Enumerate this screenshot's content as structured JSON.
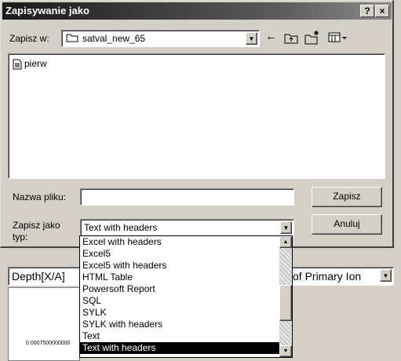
{
  "dialog": {
    "title": "Zapisywanie jako",
    "help_label": "?",
    "close_label": "×",
    "savein_label": "Zapisz w:",
    "folder": "satval_new_65",
    "files": [
      "pierw"
    ],
    "filename_label": "Nazwa pliku:",
    "filename_value": "",
    "type_label_line1": "Zapisz jako",
    "type_label_line2": "typ:",
    "type_value": "Text with headers",
    "save_button": "Zapisz",
    "cancel_button": "Anuluj"
  },
  "type_options": [
    "Excel with headers",
    "Excel5",
    "Excel5 with headers",
    "HTML Table",
    "Powersoft Report",
    "SQL",
    "SYLK",
    "SYLK with headers",
    "Text",
    "Text with headers"
  ],
  "background": {
    "depth_select": "Depth[X/A]",
    "primary_select": "of Primary Ion",
    "axis_tick": "0.0007500000000"
  }
}
